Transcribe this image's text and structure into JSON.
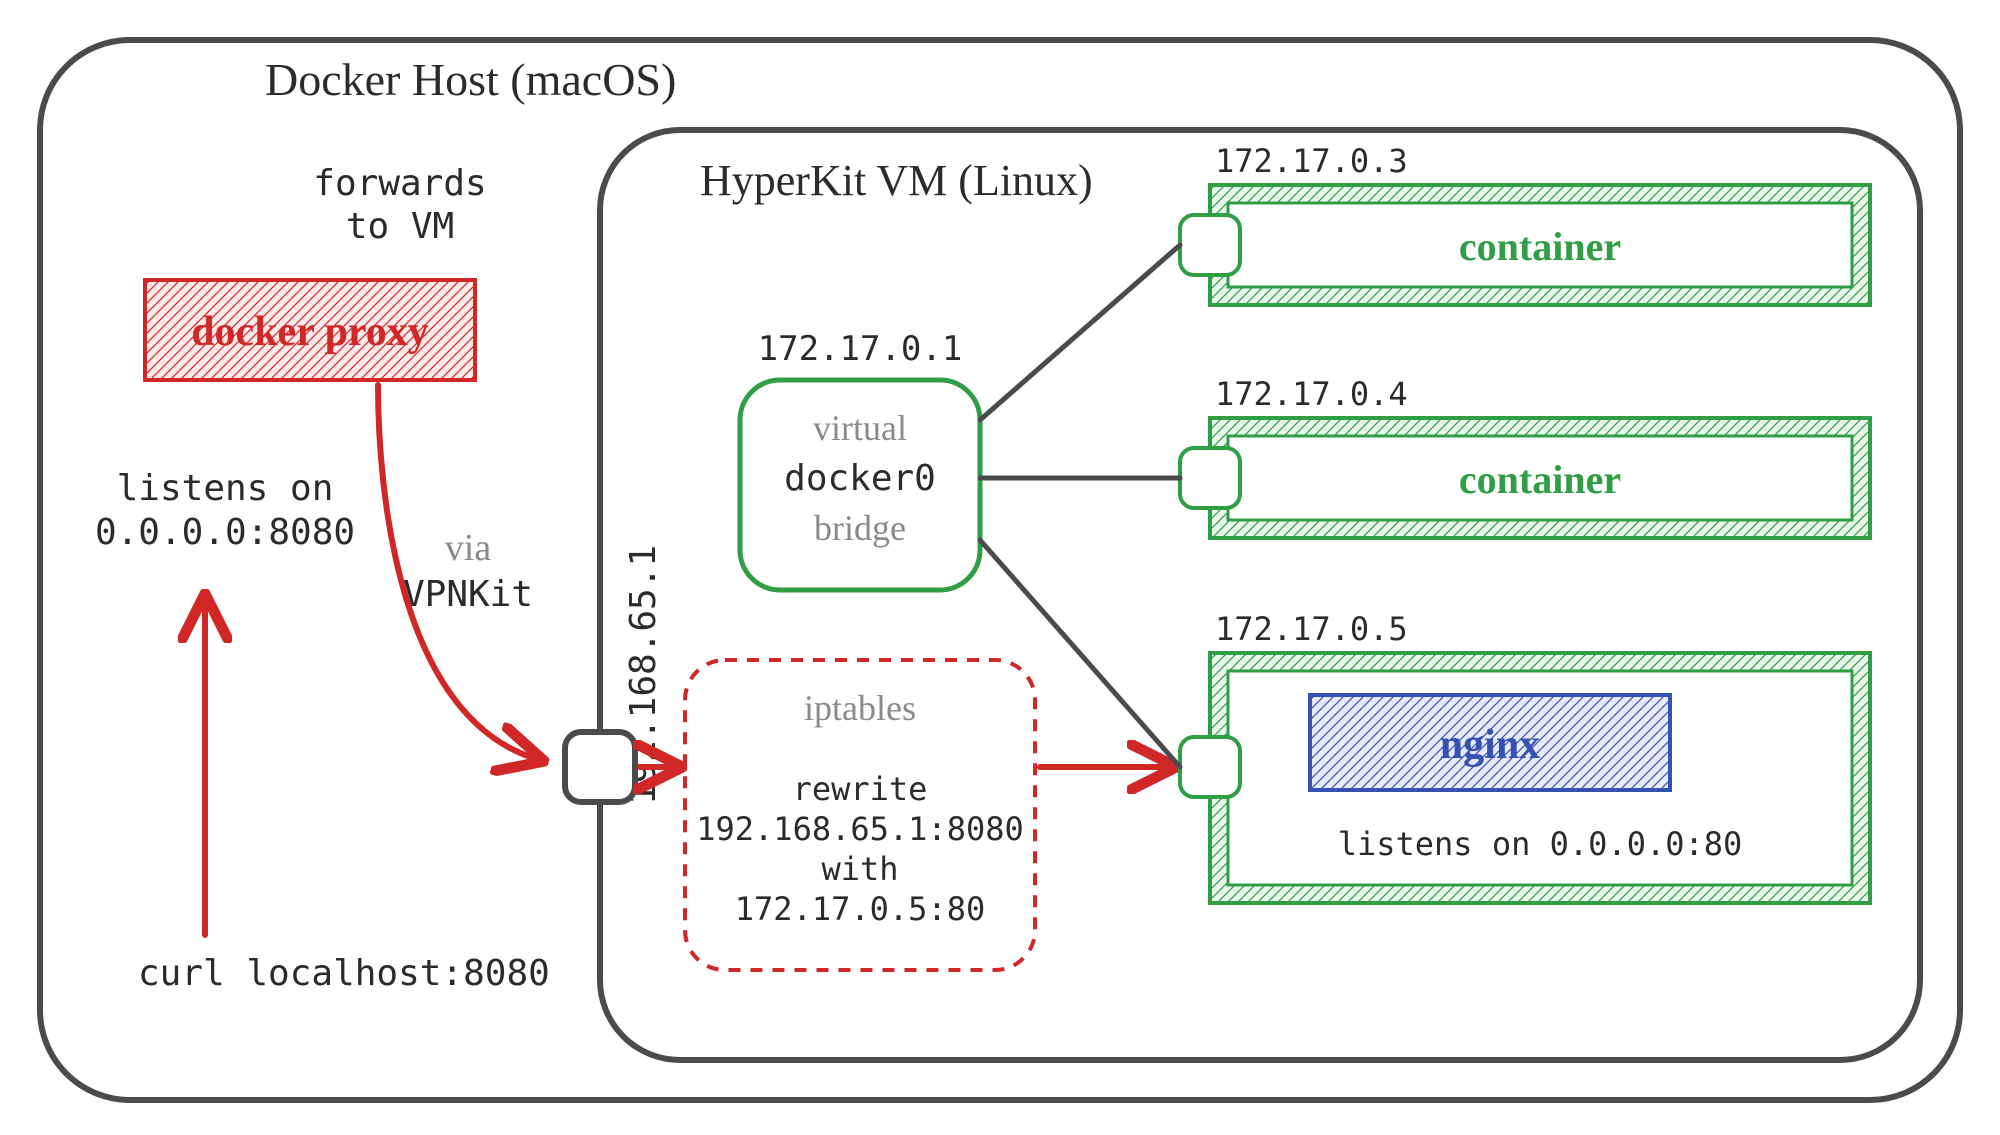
{
  "host": {
    "title": "Docker Host (macOS)",
    "proxy_label": "docker proxy",
    "forwards_line1": "forwards",
    "forwards_line2": "to VM",
    "listens_line1": "listens on",
    "listens_line2": "0.0.0.0:8080",
    "via_line1": "via",
    "via_line2": "VPNKit",
    "curl_cmd": "curl localhost:8080"
  },
  "vm": {
    "title": "HyperKit VM (Linux)",
    "ip": "192.168.65.1",
    "bridge": {
      "ip": "172.17.0.1",
      "line1": "virtual",
      "line2": "docker0",
      "line3": "bridge"
    },
    "iptables": {
      "title": "iptables",
      "rewrite": "rewrite",
      "from": "192.168.65.1:8080",
      "with": "with",
      "to": "172.17.0.5:80"
    },
    "containers": [
      {
        "ip": "172.17.0.3",
        "label": "container"
      },
      {
        "ip": "172.17.0.4",
        "label": "container"
      },
      {
        "ip": "172.17.0.5",
        "label": "nginx",
        "listens": "listens on 0.0.0.0:80",
        "inner": true
      }
    ]
  },
  "colors": {
    "frame": "#4B4B4B",
    "red": "#D22727",
    "red_fill": "#FDEBEB",
    "green": "#2F9E44",
    "green_fill": "#E9F7EC",
    "blue": "#3551B4",
    "blue_fill": "#E7EBFA",
    "text": "#2B2B2B",
    "gray": "#8A8A8A"
  }
}
